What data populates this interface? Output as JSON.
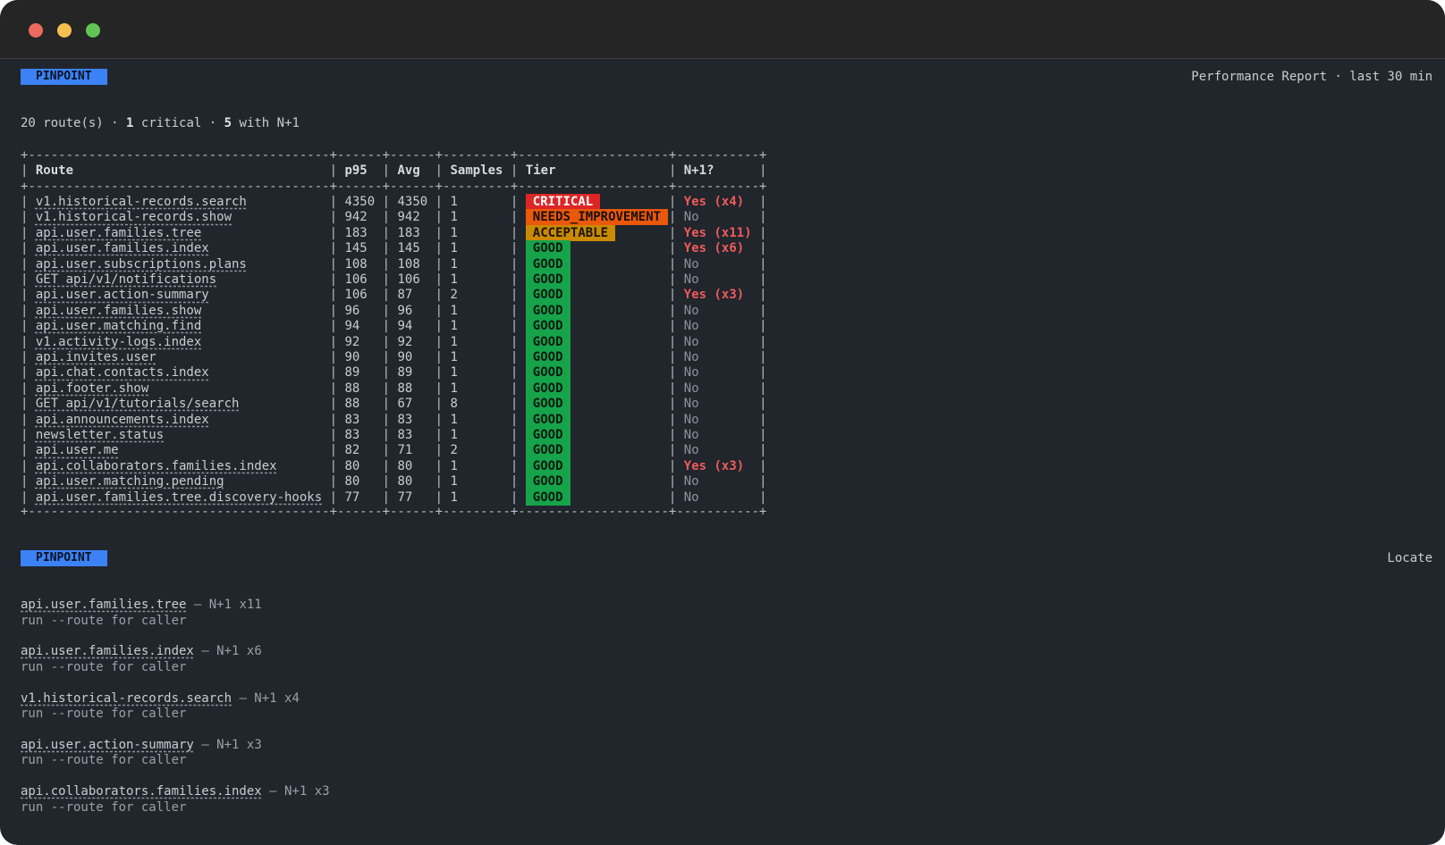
{
  "window": {
    "controls": [
      "close",
      "minimize",
      "maximize"
    ]
  },
  "report": {
    "badge": "PINPOINT",
    "title": "Performance Report · last 30 min",
    "summary": {
      "routes_count": "20",
      "routes_label": "route(s)",
      "critical_count": "1",
      "critical_label": "critical",
      "n1_count": "5",
      "n1_label": "with N+1"
    },
    "columns": [
      "Route",
      "p95",
      "Avg",
      "Samples",
      "Tier",
      "N+1?"
    ],
    "rows": [
      {
        "route": "v1.historical-records.search",
        "p95": "4350",
        "avg": "4350",
        "samples": "1",
        "tier": "CRITICAL",
        "tier_kind": "critical",
        "n1": "Yes (x4)",
        "n1_kind": "yes"
      },
      {
        "route": "v1.historical-records.show",
        "p95": "942",
        "avg": "942",
        "samples": "1",
        "tier": "NEEDS_IMPROVEMENT",
        "tier_kind": "needs",
        "n1": "No",
        "n1_kind": "no"
      },
      {
        "route": "api.user.families.tree",
        "p95": "183",
        "avg": "183",
        "samples": "1",
        "tier": "ACCEPTABLE",
        "tier_kind": "acceptable",
        "n1": "Yes (x11)",
        "n1_kind": "yes"
      },
      {
        "route": "api.user.families.index",
        "p95": "145",
        "avg": "145",
        "samples": "1",
        "tier": "GOOD",
        "tier_kind": "good",
        "n1": "Yes (x6)",
        "n1_kind": "yes"
      },
      {
        "route": "api.user.subscriptions.plans",
        "p95": "108",
        "avg": "108",
        "samples": "1",
        "tier": "GOOD",
        "tier_kind": "good",
        "n1": "No",
        "n1_kind": "no"
      },
      {
        "route": "GET api/v1/notifications",
        "p95": "106",
        "avg": "106",
        "samples": "1",
        "tier": "GOOD",
        "tier_kind": "good",
        "n1": "No",
        "n1_kind": "no"
      },
      {
        "route": "api.user.action-summary",
        "p95": "106",
        "avg": "87",
        "samples": "2",
        "tier": "GOOD",
        "tier_kind": "good",
        "n1": "Yes (x3)",
        "n1_kind": "yes"
      },
      {
        "route": "api.user.families.show",
        "p95": "96",
        "avg": "96",
        "samples": "1",
        "tier": "GOOD",
        "tier_kind": "good",
        "n1": "No",
        "n1_kind": "no"
      },
      {
        "route": "api.user.matching.find",
        "p95": "94",
        "avg": "94",
        "samples": "1",
        "tier": "GOOD",
        "tier_kind": "good",
        "n1": "No",
        "n1_kind": "no"
      },
      {
        "route": "v1.activity-logs.index",
        "p95": "92",
        "avg": "92",
        "samples": "1",
        "tier": "GOOD",
        "tier_kind": "good",
        "n1": "No",
        "n1_kind": "no"
      },
      {
        "route": "api.invites.user",
        "p95": "90",
        "avg": "90",
        "samples": "1",
        "tier": "GOOD",
        "tier_kind": "good",
        "n1": "No",
        "n1_kind": "no"
      },
      {
        "route": "api.chat.contacts.index",
        "p95": "89",
        "avg": "89",
        "samples": "1",
        "tier": "GOOD",
        "tier_kind": "good",
        "n1": "No",
        "n1_kind": "no"
      },
      {
        "route": "api.footer.show",
        "p95": "88",
        "avg": "88",
        "samples": "1",
        "tier": "GOOD",
        "tier_kind": "good",
        "n1": "No",
        "n1_kind": "no"
      },
      {
        "route": "GET api/v1/tutorials/search",
        "p95": "88",
        "avg": "67",
        "samples": "8",
        "tier": "GOOD",
        "tier_kind": "good",
        "n1": "No",
        "n1_kind": "no"
      },
      {
        "route": "api.announcements.index",
        "p95": "83",
        "avg": "83",
        "samples": "1",
        "tier": "GOOD",
        "tier_kind": "good",
        "n1": "No",
        "n1_kind": "no"
      },
      {
        "route": "newsletter.status",
        "p95": "83",
        "avg": "83",
        "samples": "1",
        "tier": "GOOD",
        "tier_kind": "good",
        "n1": "No",
        "n1_kind": "no"
      },
      {
        "route": "api.user.me",
        "p95": "82",
        "avg": "71",
        "samples": "2",
        "tier": "GOOD",
        "tier_kind": "good",
        "n1": "No",
        "n1_kind": "no"
      },
      {
        "route": "api.collaborators.families.index",
        "p95": "80",
        "avg": "80",
        "samples": "1",
        "tier": "GOOD",
        "tier_kind": "good",
        "n1": "Yes (x3)",
        "n1_kind": "yes"
      },
      {
        "route": "api.user.matching.pending",
        "p95": "80",
        "avg": "80",
        "samples": "1",
        "tier": "GOOD",
        "tier_kind": "good",
        "n1": "No",
        "n1_kind": "no"
      },
      {
        "route": "api.user.families.tree.discovery-hooks",
        "p95": "77",
        "avg": "77",
        "samples": "1",
        "tier": "GOOD",
        "tier_kind": "good",
        "n1": "No",
        "n1_kind": "no"
      }
    ]
  },
  "locate": {
    "badge": "PINPOINT",
    "title": "Locate",
    "items": [
      {
        "route": "api.user.families.tree",
        "detail": "— N+1 x11",
        "hint": "run --route for caller"
      },
      {
        "route": "api.user.families.index",
        "detail": "— N+1 x6",
        "hint": "run --route for caller"
      },
      {
        "route": "v1.historical-records.search",
        "detail": "— N+1 x4",
        "hint": "run --route for caller"
      },
      {
        "route": "api.user.action-summary",
        "detail": "— N+1 x3",
        "hint": "run --route for caller"
      },
      {
        "route": "api.collaborators.families.index",
        "detail": "— N+1 x3",
        "hint": "run --route for caller"
      }
    ]
  },
  "colors": {
    "background": "#21252c",
    "badge": "#3b82f6",
    "critical": "#dc2626",
    "needs_improvement": "#ea580c",
    "acceptable": "#ca8a04",
    "good": "#16a34a",
    "yes": "#ef5b5b"
  }
}
